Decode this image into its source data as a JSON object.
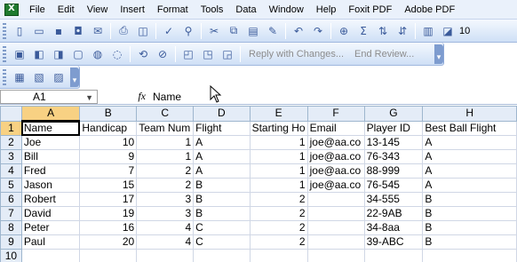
{
  "menu": [
    "File",
    "Edit",
    "View",
    "Insert",
    "Format",
    "Tools",
    "Data",
    "Window",
    "Help",
    "Foxit PDF",
    "Adobe PDF"
  ],
  "toolbar_number": "10",
  "review_toolbar": {
    "reply_label": "Reply with Changes...",
    "end_label": "End Review..."
  },
  "formula_bar": {
    "name_box": "A1",
    "fx": "fx",
    "formula": "Name"
  },
  "columns": [
    "A",
    "B",
    "C",
    "D",
    "E",
    "F",
    "G",
    "H"
  ],
  "rows": [
    {
      "num": "1",
      "cells": [
        "Name",
        "Handicap",
        "Team Num",
        "Flight",
        "Starting Ho",
        "Email",
        "Player ID",
        "Best Ball Flight"
      ]
    },
    {
      "num": "2",
      "cells": [
        "Joe",
        "10",
        "1",
        "A",
        "1",
        "joe@aa.co",
        "13-145",
        "A"
      ]
    },
    {
      "num": "3",
      "cells": [
        "Bill",
        "9",
        "1",
        "A",
        "1",
        "joe@aa.co",
        "76-343",
        "A"
      ]
    },
    {
      "num": "4",
      "cells": [
        "Fred",
        "7",
        "2",
        "A",
        "1",
        "joe@aa.co",
        "88-999",
        "A"
      ]
    },
    {
      "num": "5",
      "cells": [
        "Jason",
        "15",
        "2",
        "B",
        "1",
        "joe@aa.co",
        "76-545",
        "A"
      ]
    },
    {
      "num": "6",
      "cells": [
        "Robert",
        "17",
        "3",
        "B",
        "2",
        "",
        "34-555",
        "B"
      ]
    },
    {
      "num": "7",
      "cells": [
        "David",
        "19",
        "3",
        "B",
        "2",
        "",
        "22-9AB",
        "B"
      ]
    },
    {
      "num": "8",
      "cells": [
        "Peter",
        "16",
        "4",
        "C",
        "2",
        "",
        "34-8aa",
        "B"
      ]
    },
    {
      "num": "9",
      "cells": [
        "Paul",
        "20",
        "4",
        "C",
        "2",
        "",
        "39-ABC",
        "B"
      ]
    },
    {
      "num": "10",
      "cells": [
        "",
        "",
        "",
        "",
        "",
        "",
        "",
        ""
      ]
    }
  ]
}
